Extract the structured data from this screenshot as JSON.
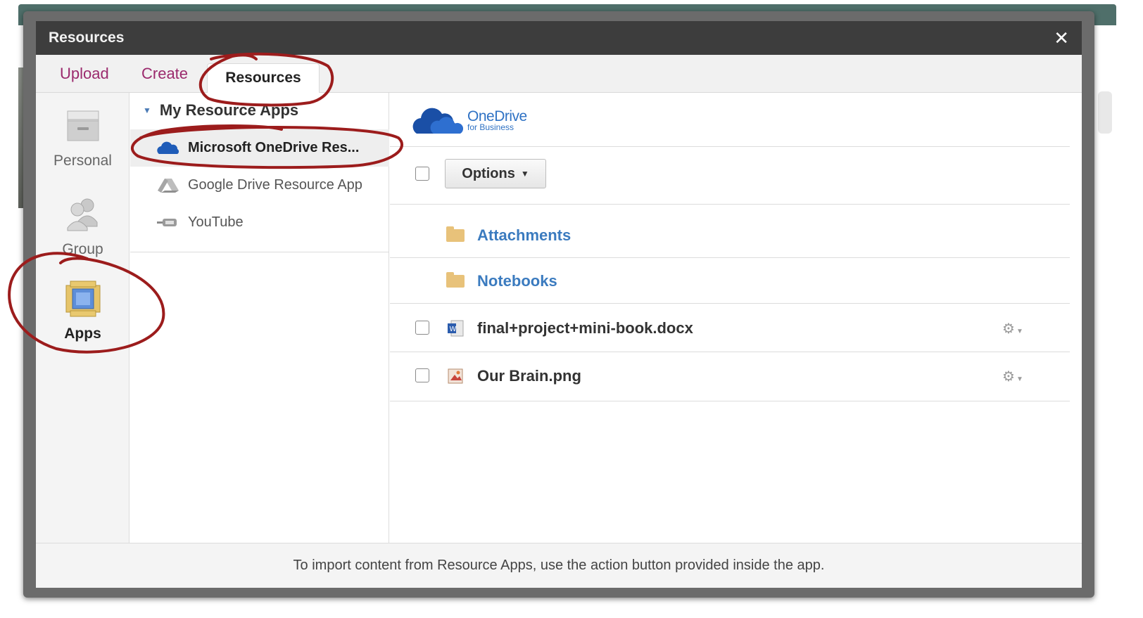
{
  "modal": {
    "title": "Resources"
  },
  "tabs": [
    {
      "label": "Upload"
    },
    {
      "label": "Create"
    },
    {
      "label": "Resources"
    }
  ],
  "sidebar": {
    "items": [
      {
        "label": "Personal",
        "icon": "drawer-icon"
      },
      {
        "label": "Group",
        "icon": "group-icon"
      },
      {
        "label": "Apps",
        "icon": "apps-icon"
      }
    ]
  },
  "apps_panel": {
    "header": "My Resource Apps",
    "items": [
      {
        "label": "Microsoft OneDrive Res...",
        "icon": "onedrive-icon"
      },
      {
        "label": "Google Drive Resource App",
        "icon": "google-drive-icon"
      },
      {
        "label": "YouTube",
        "icon": "youtube-icon"
      }
    ]
  },
  "content": {
    "logo_main": "OneDrive",
    "logo_sub": "for Business",
    "options_label": "Options",
    "folders": [
      {
        "name": "Attachments"
      },
      {
        "name": "Notebooks"
      }
    ],
    "files": [
      {
        "name": "final+project+mini-book.docx",
        "icon": "word-doc-icon"
      },
      {
        "name": "Our Brain.png",
        "icon": "image-file-icon"
      }
    ]
  },
  "footer": {
    "text": "To import content from Resource Apps, use the action button provided inside the app."
  },
  "colors": {
    "tab_link": "#9b2a6d",
    "folder_link": "#3b7bbf",
    "annotation": "#9c1c1c",
    "onedrive_blue": "#2f72c4"
  }
}
